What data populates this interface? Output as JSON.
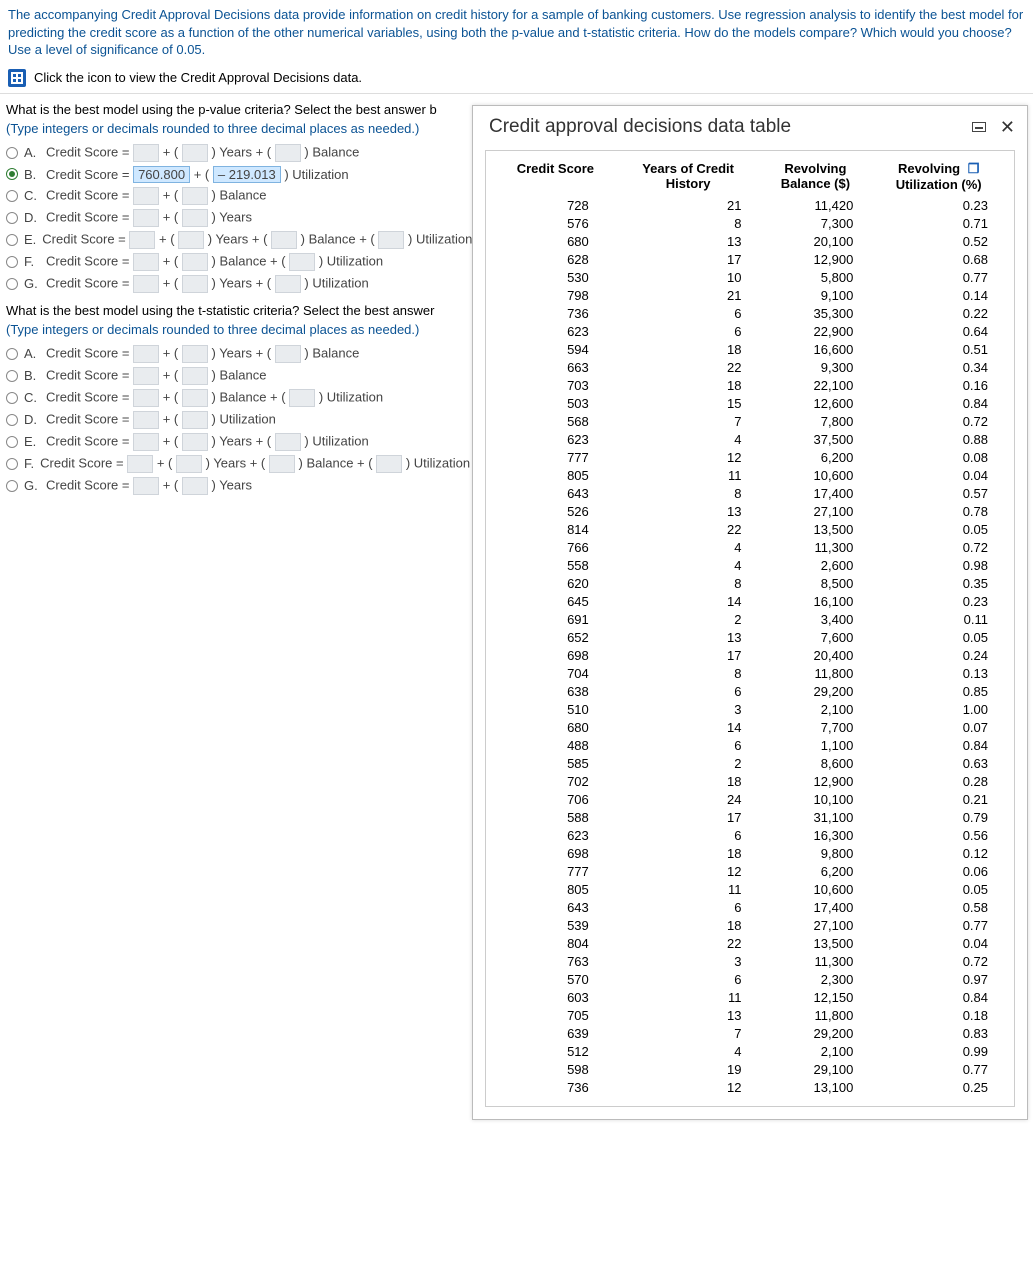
{
  "prompt": "The accompanying Credit Approval Decisions data provide information on credit history for a sample of banking customers. Use regression analysis to identify the best model for predicting the credit score as a function of the other numerical variables, using both the p-value and t-statistic criteria. How do the models compare? Which would you choose? Use a level of significance of 0.05.",
  "view_link": "Click the icon to view the Credit Approval Decisions data.",
  "q1": {
    "text": "What is the best model using the p-value criteria? Select the best answer b",
    "hint": "(Type integers or decimals rounded to three decimal places as needed.)",
    "opts": {
      "A": {
        "pre": "Credit Score =",
        "a": "",
        "mid1": "+ (",
        "b": "",
        "mid2": ") Years + (",
        "c": "",
        "post": ") Balance"
      },
      "B": {
        "pre": "Credit Score =",
        "val1": "760.800",
        "mid": "+ (",
        "val2": "– 219.013",
        "post": ") Utilization",
        "selected": true
      },
      "C": {
        "pre": "Credit Score =",
        "a": "",
        "mid1": "+ (",
        "b": "",
        "post": ") Balance"
      },
      "D": {
        "pre": "Credit Score =",
        "a": "",
        "mid1": "+ (",
        "b": "",
        "post": ") Years"
      },
      "E": {
        "pre": "Credit Score =",
        "a": "",
        "mid1": "+ (",
        "b": "",
        "mid2": ") Years + (",
        "c": "",
        "mid3": ") Balance + (",
        "d": "",
        "post": ") Utilization"
      },
      "F": {
        "pre": "Credit Score =",
        "a": "",
        "mid1": "+ (",
        "b": "",
        "mid2": ") Balance + (",
        "c": "",
        "post": ") Utilization"
      },
      "G": {
        "pre": "Credit Score =",
        "a": "",
        "mid1": "+ (",
        "b": "",
        "mid2": ") Years + (",
        "c": "",
        "post": ") Utilization"
      }
    }
  },
  "q2": {
    "text": "What is the best model using the t-statistic criteria? Select the best answer",
    "hint": "(Type integers or decimals rounded to three decimal places as needed.)",
    "opts": {
      "A": {
        "pre": "Credit Score =",
        "a": "",
        "mid1": "+ (",
        "b": "",
        "mid2": ") Years + (",
        "c": "",
        "post": ") Balance"
      },
      "B": {
        "pre": "Credit Score =",
        "a": "",
        "mid1": "+ (",
        "b": "",
        "post": ") Balance"
      },
      "C": {
        "pre": "Credit Score =",
        "a": "",
        "mid1": "+ (",
        "b": "",
        "mid2": ") Balance + (",
        "c": "",
        "post": ") Utilization"
      },
      "D": {
        "pre": "Credit Score =",
        "a": "",
        "mid1": "+ (",
        "b": "",
        "post": ") Utilization"
      },
      "E": {
        "pre": "Credit Score =",
        "a": "",
        "mid1": "+ (",
        "b": "",
        "mid2": ") Years + (",
        "c": "",
        "post": ") Utilization"
      },
      "F": {
        "pre": "Credit Score =",
        "a": "",
        "mid1": "+ (",
        "b": "",
        "mid2": ") Years + (",
        "c": "",
        "mid3": ") Balance + (",
        "d": "",
        "post": ") Utilization"
      },
      "G": {
        "pre": "Credit Score =",
        "a": "",
        "mid1": "+ (",
        "b": "",
        "post": ") Years"
      }
    }
  },
  "panel": {
    "title": "Credit approval decisions data table",
    "headers": [
      "Credit Score",
      "Years of Credit History",
      "Revolving Balance ($)",
      "Revolving Utilization (%)"
    ],
    "rows": [
      [
        728,
        21,
        "11,420",
        "0.23"
      ],
      [
        576,
        8,
        "7,300",
        "0.71"
      ],
      [
        680,
        13,
        "20,100",
        "0.52"
      ],
      [
        628,
        17,
        "12,900",
        "0.68"
      ],
      [
        530,
        10,
        "5,800",
        "0.77"
      ],
      [
        798,
        21,
        "9,100",
        "0.14"
      ],
      [
        736,
        6,
        "35,300",
        "0.22"
      ],
      [
        623,
        6,
        "22,900",
        "0.64"
      ],
      [
        594,
        18,
        "16,600",
        "0.51"
      ],
      [
        663,
        22,
        "9,300",
        "0.34"
      ],
      [
        703,
        18,
        "22,100",
        "0.16"
      ],
      [
        503,
        15,
        "12,600",
        "0.84"
      ],
      [
        568,
        7,
        "7,800",
        "0.72"
      ],
      [
        623,
        4,
        "37,500",
        "0.88"
      ],
      [
        777,
        12,
        "6,200",
        "0.08"
      ],
      [
        805,
        11,
        "10,600",
        "0.04"
      ],
      [
        643,
        8,
        "17,400",
        "0.57"
      ],
      [
        526,
        13,
        "27,100",
        "0.78"
      ],
      [
        814,
        22,
        "13,500",
        "0.05"
      ],
      [
        766,
        4,
        "11,300",
        "0.72"
      ],
      [
        558,
        4,
        "2,600",
        "0.98"
      ],
      [
        620,
        8,
        "8,500",
        "0.35"
      ],
      [
        645,
        14,
        "16,100",
        "0.23"
      ],
      [
        691,
        2,
        "3,400",
        "0.11"
      ],
      [
        652,
        13,
        "7,600",
        "0.05"
      ],
      [
        698,
        17,
        "20,400",
        "0.24"
      ],
      [
        704,
        8,
        "11,800",
        "0.13"
      ],
      [
        638,
        6,
        "29,200",
        "0.85"
      ],
      [
        510,
        3,
        "2,100",
        "1.00"
      ],
      [
        680,
        14,
        "7,700",
        "0.07"
      ],
      [
        488,
        6,
        "1,100",
        "0.84"
      ],
      [
        585,
        2,
        "8,600",
        "0.63"
      ],
      [
        702,
        18,
        "12,900",
        "0.28"
      ],
      [
        706,
        24,
        "10,100",
        "0.21"
      ],
      [
        588,
        17,
        "31,100",
        "0.79"
      ],
      [
        623,
        6,
        "16,300",
        "0.56"
      ],
      [
        698,
        18,
        "9,800",
        "0.12"
      ],
      [
        777,
        12,
        "6,200",
        "0.06"
      ],
      [
        805,
        11,
        "10,600",
        "0.05"
      ],
      [
        643,
        6,
        "17,400",
        "0.58"
      ],
      [
        539,
        18,
        "27,100",
        "0.77"
      ],
      [
        804,
        22,
        "13,500",
        "0.04"
      ],
      [
        763,
        3,
        "11,300",
        "0.72"
      ],
      [
        570,
        6,
        "2,300",
        "0.97"
      ],
      [
        603,
        11,
        "12,150",
        "0.84"
      ],
      [
        705,
        13,
        "11,800",
        "0.18"
      ],
      [
        639,
        7,
        "29,200",
        "0.83"
      ],
      [
        512,
        4,
        "2,100",
        "0.99"
      ],
      [
        598,
        19,
        "29,100",
        "0.77"
      ],
      [
        736,
        12,
        "13,100",
        "0.25"
      ]
    ]
  }
}
